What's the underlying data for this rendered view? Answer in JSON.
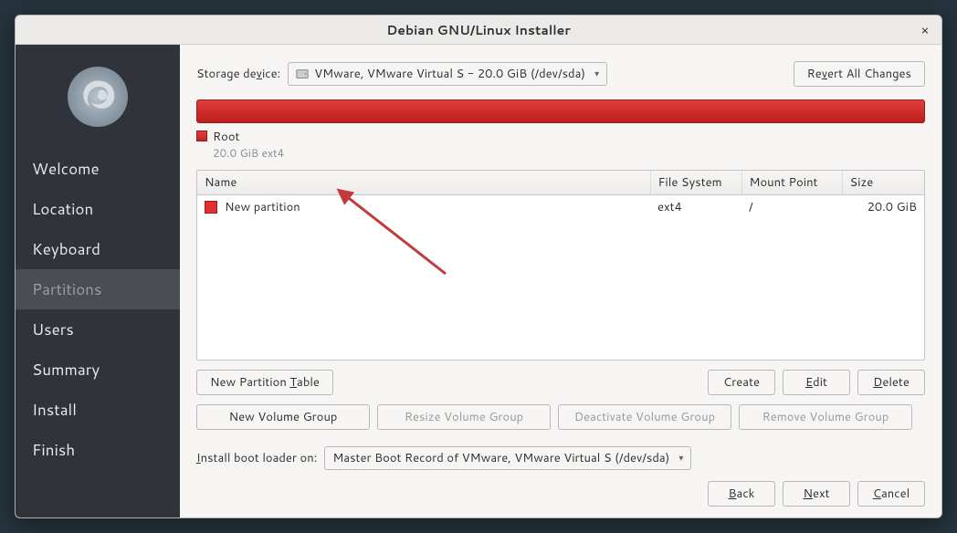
{
  "window": {
    "title": "Debian GNU/Linux Installer",
    "close": "×"
  },
  "sidebar": {
    "items": [
      {
        "label": "Welcome",
        "state": "past"
      },
      {
        "label": "Location",
        "state": "past"
      },
      {
        "label": "Keyboard",
        "state": "past"
      },
      {
        "label": "Partitions",
        "state": "active"
      },
      {
        "label": "Users",
        "state": "future"
      },
      {
        "label": "Summary",
        "state": "future"
      },
      {
        "label": "Install",
        "state": "future"
      },
      {
        "label": "Finish",
        "state": "future"
      }
    ]
  },
  "storage": {
    "label": "Storage de",
    "label_ul": "v",
    "label_after": "ice:",
    "device": "VMware, VMware Virtual S - 20.0 GiB (/dev/sda)",
    "revert_btn": "Re",
    "revert_ul": "v",
    "revert_after": "ert All Changes"
  },
  "legend": {
    "name": "Root",
    "sub": "20.0 GiB  ext4",
    "color": "#d9281e"
  },
  "table": {
    "cols": {
      "name": "Name",
      "fs": "File System",
      "mount": "Mount Point",
      "size": "Size"
    },
    "rows": [
      {
        "name": "New partition",
        "fs": "ext4",
        "mount": "/",
        "size": "20.0 GiB"
      }
    ]
  },
  "buttons": {
    "new_table_pre": "New Partition ",
    "new_table_ul": "T",
    "new_table_post": "able",
    "create": "Create",
    "edit_ul": "E",
    "edit_post": "dit",
    "delete_ul": "D",
    "delete_post": "elete",
    "new_vg": "New Volume Group",
    "resize_vg": "Resize Volume Group",
    "deact_vg": "Deactivate Volume Group",
    "remove_vg": "Remove Volume Group"
  },
  "boot": {
    "label_ul": "I",
    "label_post": "nstall boot loader on:",
    "value": "Master Boot Record of VMware, VMware Virtual S (/dev/sda)"
  },
  "footer": {
    "back_ul": "B",
    "back_post": "ack",
    "next_ul": "N",
    "next_post": "ext",
    "cancel_ul": "C",
    "cancel_post": "ancel"
  }
}
